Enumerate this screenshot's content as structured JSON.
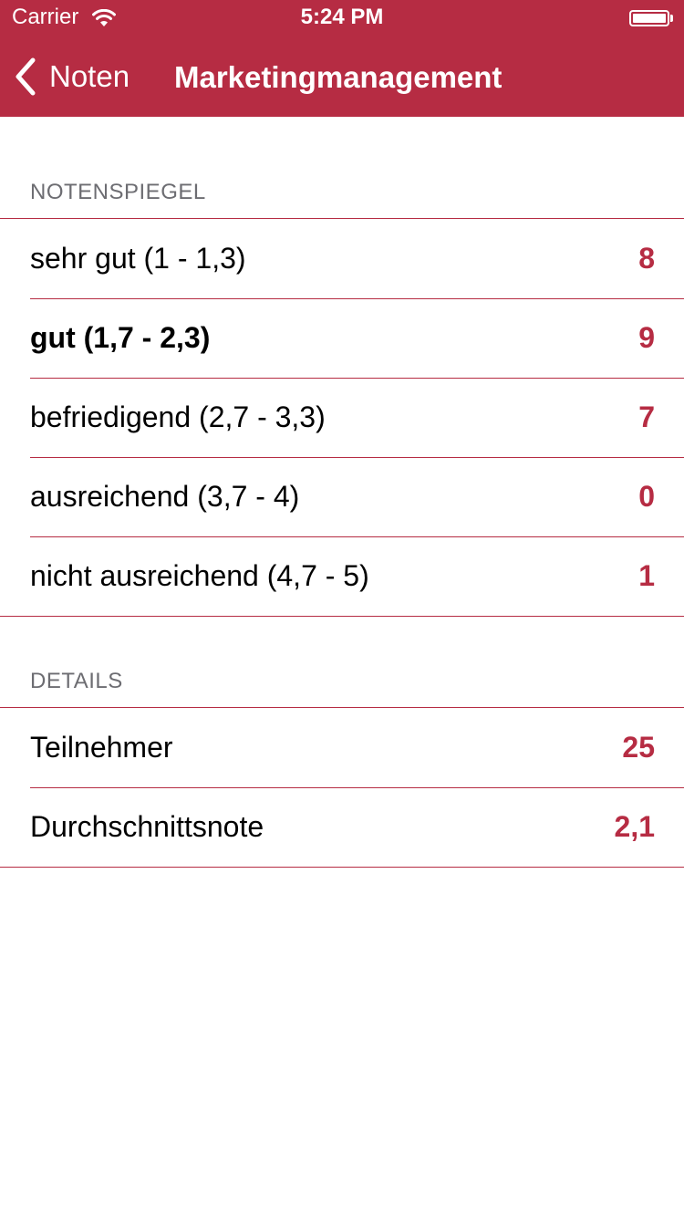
{
  "status_bar": {
    "carrier": "Carrier",
    "time": "5:24 PM",
    "wifi_icon": "wifi-icon",
    "battery_icon": "battery-icon"
  },
  "nav": {
    "back_label": "Noten",
    "back_icon": "chevron-left-icon",
    "title": "Marketingmanagement"
  },
  "colors": {
    "accent": "#b62c43",
    "header_text": "#6d6d72"
  },
  "sections": {
    "notenspiegel": {
      "header": "NOTENSPIEGEL",
      "rows": [
        {
          "label": "sehr gut (1 - 1,3)",
          "value": "8"
        },
        {
          "label": "gut (1,7 - 2,3)",
          "value": "9"
        },
        {
          "label": "befriedigend (2,7 - 3,3)",
          "value": "7"
        },
        {
          "label": "ausreichend (3,7 - 4)",
          "value": "0"
        },
        {
          "label": "nicht ausreichend (4,7 - 5)",
          "value": "1"
        }
      ]
    },
    "details": {
      "header": "DETAILS",
      "rows": [
        {
          "label": "Teilnehmer",
          "value": "25"
        },
        {
          "label": "Durchschnittsnote",
          "value": "2,1"
        }
      ]
    }
  }
}
